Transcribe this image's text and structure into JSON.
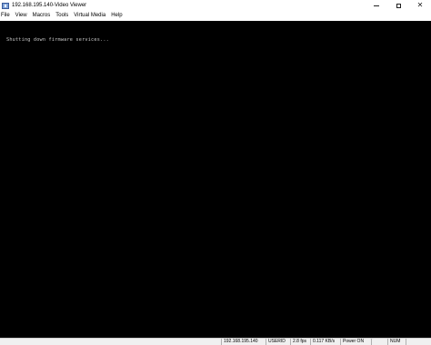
{
  "window": {
    "title": "192.168.195.140-Video Viewer",
    "controls": {
      "minimize_icon": "minimize-icon",
      "maximize_icon": "maximize-icon",
      "close_label": "✕"
    }
  },
  "menubar": {
    "items": [
      {
        "label": "File"
      },
      {
        "label": "View"
      },
      {
        "label": "Macros"
      },
      {
        "label": "Tools"
      },
      {
        "label": "Virtual Media"
      },
      {
        "label": "Help"
      }
    ]
  },
  "console": {
    "line": "Shutting down firmware services...",
    "background": "#000000",
    "text_color": "#c8c8c8"
  },
  "statusbar": {
    "ip": "192.168.195.140",
    "user": "USERID",
    "fps": "2.8 fps",
    "rate": "0.117 KB/s",
    "power": "Power ON",
    "num": "NUM"
  }
}
